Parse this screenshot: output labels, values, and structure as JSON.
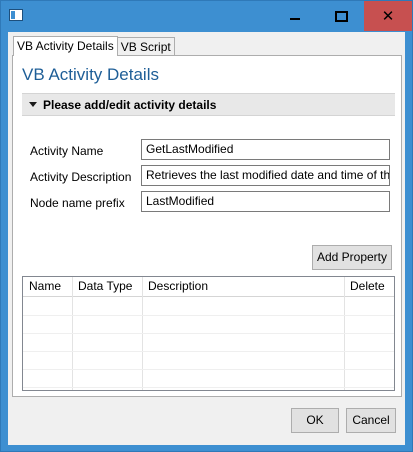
{
  "window": {
    "icon": "app-window-icon",
    "controls": {
      "minimize": "minimize-icon",
      "maximize": "maximize-icon",
      "close": "close-icon"
    }
  },
  "tabs": [
    {
      "label": "VB Activity Details",
      "active": true
    },
    {
      "label": "VB Script",
      "active": false
    }
  ],
  "panel": {
    "title": "VB Activity Details",
    "section_label": "Please add/edit activity details"
  },
  "form": {
    "activity_name_label": "Activity Name",
    "activity_name_value": "GetLastModified",
    "activity_description_label": "Activity Description",
    "activity_description_value": "Retrieves the last modified date and time of the",
    "node_prefix_label": "Node name prefix",
    "node_prefix_value": "LastModified"
  },
  "properties": {
    "add_button_label": "Add Property",
    "columns": [
      "Name",
      "Data Type",
      "Description",
      "Delete"
    ],
    "rows": []
  },
  "footer": {
    "ok_label": "OK",
    "cancel_label": "Cancel"
  },
  "colors": {
    "title_bar": "#3d8fd1",
    "close_button": "#c75050",
    "panel_title": "#1e5e97"
  }
}
